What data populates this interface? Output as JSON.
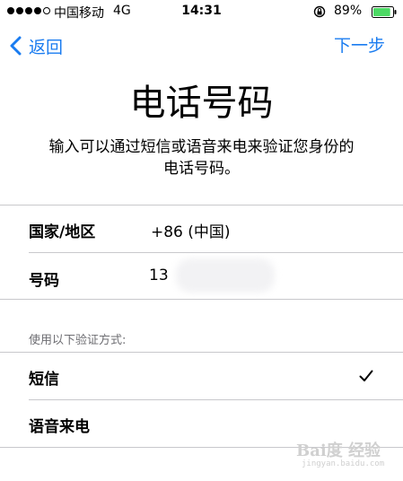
{
  "status_bar": {
    "carrier": "中国移动",
    "network": "4G",
    "time": "14:31",
    "battery": "89%",
    "signal_bars_filled": 4,
    "signal_bars_total": 5
  },
  "nav": {
    "back_label": "返回",
    "next_label": "下一步"
  },
  "header": {
    "title": "电话号码",
    "subtitle": "输入可以通过短信或语音来电来验证您身份的电话号码。"
  },
  "form": {
    "country_label": "国家/地区",
    "country_value": "+86 (中国)",
    "number_label": "号码",
    "number_value": "13"
  },
  "verification": {
    "section_header": "使用以下验证方式:",
    "options": [
      {
        "label": "短信",
        "selected": true
      },
      {
        "label": "语音来电",
        "selected": false
      }
    ]
  },
  "watermark": {
    "logo": "Bai度 经验",
    "url": "jingyan.baidu.com"
  },
  "colors": {
    "accent": "#1a7cf0",
    "battery_fill": "#4cd964",
    "divider": "#c8c8cc"
  }
}
